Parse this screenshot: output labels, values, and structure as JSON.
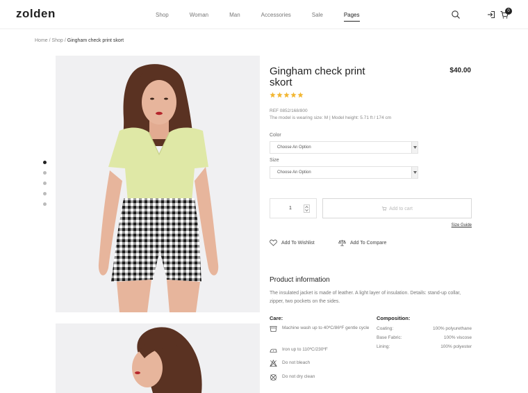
{
  "header": {
    "logo": "zolden",
    "nav": [
      {
        "label": "Shop"
      },
      {
        "label": "Woman"
      },
      {
        "label": "Man"
      },
      {
        "label": "Accessories"
      },
      {
        "label": "Sale"
      },
      {
        "label": "Pages",
        "active": true
      }
    ],
    "cart_count": "0",
    "icons": [
      "search-icon",
      "login-icon",
      "cart-icon"
    ]
  },
  "breadcrumb": {
    "home": "Home",
    "sep1": "/",
    "shop": "Shop",
    "sep2": "/",
    "current": "Gingham check print skort"
  },
  "gallery": {
    "dots_count": 5,
    "active_dot": 1
  },
  "product": {
    "title": "Gingham check print skort",
    "price": "$40.00",
    "rating": 5,
    "ref": "REF 0852/168/800",
    "model_info": "The model is wearing size: M | Model height: 5.71 ft / 174 cm",
    "color_label": "Color",
    "color_placeholder": "Choose An Option",
    "size_label": "Size",
    "size_placeholder": "Choose An Option",
    "quantity": "1",
    "add_to_cart": "Add to cart",
    "size_guide": "Size Guide",
    "wishlist": "Add To Wishlist",
    "compare": "Add To Compare"
  },
  "info": {
    "title": "Product information",
    "description": "The insulated jacket is made of leather. A light layer of insulation. Details: stand-up collar, zipper, two pockets on the sides.",
    "care_title": "Care:",
    "care": [
      {
        "icon": "machine-wash-icon",
        "text": "Machine wash up to 40ºC/86ºF gentle cycle"
      },
      {
        "icon": "iron-icon",
        "text": "Iron up to 110ºC/230ºF"
      },
      {
        "icon": "no-bleach-icon",
        "text": "Do not bleach"
      },
      {
        "icon": "no-dry-clean-icon",
        "text": "Do not dry clean"
      }
    ],
    "composition_title": "Composition:",
    "composition": [
      {
        "part": "Coating:",
        "value": "100% polyurethane"
      },
      {
        "part": "Base Fabric:",
        "value": "100% viscose"
      },
      {
        "part": "Lining:",
        "value": "100% polyester"
      }
    ]
  },
  "colors": {
    "star": "#f2b632",
    "top": "#dfe8a6",
    "hair": "#5a3222",
    "skin": "#e7b59c",
    "photo_bg": "#f0f0f2"
  }
}
